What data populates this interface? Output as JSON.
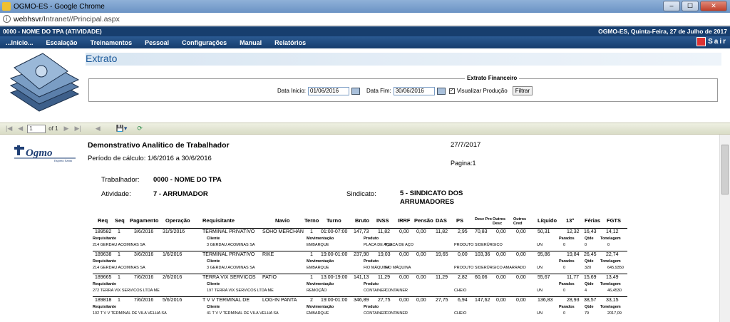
{
  "window": {
    "title": "OGMO-ES - Google Chrome",
    "btn_min": "–",
    "btn_max": "☐",
    "btn_close": "✕"
  },
  "address": {
    "host": "webhsvr",
    "path": "/Intranet//Principal.aspx"
  },
  "infobar": {
    "left": "0000 - NOME DO TPA (ATIVIDADE)",
    "right": "OGMO-ES, Quinta-Feira, 27 de Julho de 2017"
  },
  "menu": [
    "...Inicio...",
    "Escalação",
    "Treinamentos",
    "Pessoal",
    "Configurações",
    "Manual",
    "Relatórios"
  ],
  "sair": "Sair",
  "page": {
    "title": "Extrato"
  },
  "filter": {
    "legend": "Extrato Financeiro",
    "data_inicio_label": "Data Inicio:",
    "data_inicio": "01/06/2016",
    "data_fim_label": "Data Fim:",
    "data_fim": "30/06/2016",
    "visualizar_label": "Visualizar Produção",
    "filtrar": "Filtrar"
  },
  "toolbar": {
    "page": "1",
    "of": "of 1"
  },
  "report": {
    "logo_text": "Ogmo",
    "logo_sub": "Espírito Santo",
    "title": "Demonstrativo Analítico de Trabalhador",
    "date": "27/7/2017",
    "periodo": "Período de cálculo: 1/6/2016 a 30/6/2016",
    "pagina": "Pagina:1",
    "trabalhador_label": "Trabalhador:",
    "trabalhador": "0000 - NOME DO TPA",
    "atividade_label": "Atividade:",
    "atividade": "7 - ARRUMADOR",
    "sindicato_label": "Sindicato:",
    "sindicato_1": "5 - SINDICATO DOS",
    "sindicato_2": "ARRUMADORES",
    "headers": [
      "Req",
      "Seq",
      "Pagamento",
      "Operação",
      "Requisitante",
      "Navio",
      "Terno",
      "Turno",
      "Bruto",
      "INSS",
      "IRRF",
      "Pensão",
      "DAS",
      "PS",
      "Desc Pro",
      "Outros Desc",
      "Outros Cred",
      "Líquido",
      "13°",
      "Férias",
      "FGTS"
    ],
    "sub_headers": [
      "Requisitante",
      "Cliente",
      "Movimentação",
      "Produto",
      "Parados",
      "Qtde",
      "Tonelagem"
    ],
    "rows": [
      {
        "cells": [
          "189582",
          "1",
          "3/6/2016",
          "31/5/2016",
          "TERMINAL PRIVATIVO",
          "SOHO MERCHAN",
          "1",
          "01:00-07:00",
          "147,73",
          "11,82",
          "0,00",
          "0,00",
          "11,82",
          "2,95",
          "70,83",
          "0,00",
          "0,00",
          "50,31",
          "12,32",
          "16,43",
          "14,12"
        ],
        "sub": [
          "214 GERDAU ACOMINAS SA",
          "3 GERDAU ACOMINAS SA",
          "EMBARQUE",
          "PLACA DE AÇO",
          "PLACA DE AÇO",
          "PRODUTO SIDERÚRGICO",
          "UN",
          "0",
          "0",
          "0"
        ]
      },
      {
        "cells": [
          "189638",
          "1",
          "3/6/2016",
          "1/6/2016",
          "TERMINAL PRIVATIVO",
          "RIKE",
          "1",
          "19:00-01:00",
          "237,90",
          "19,03",
          "0,00",
          "0,00",
          "19,65",
          "0,00",
          "103,36",
          "0,00",
          "0,00",
          "95,86",
          "19,84",
          "26,45",
          "22,74"
        ],
        "sub": [
          "214 GERDAU ACOMINAS SA",
          "3 GERDAU ACOMINAS SA",
          "EMBARQUE",
          "FIO MÁQUINA",
          "FIO MÁQUINA",
          "PRODUTO SIDERÚRGICO AMARRADO",
          "UN",
          "0",
          "320",
          "645,9350"
        ]
      },
      {
        "cells": [
          "189665",
          "1",
          "7/6/2016",
          "2/6/2016",
          "TERRA VIX SERVICOS",
          "PATIO",
          "1",
          "13:00-19:00",
          "141,13",
          "11,29",
          "0,00",
          "0,00",
          "11,29",
          "2,82",
          "60,06",
          "0,00",
          "0,00",
          "55,67",
          "11,77",
          "15,69",
          "13,49"
        ],
        "sub": [
          "272 TERRA VIX SERVICOS LTDA ME",
          "197 TERRA VIX SERVICOS LTDA ME",
          "REMOÇÃO",
          "CONTAINER",
          "CONTAINER",
          "CHEIO",
          "UN",
          "0",
          "4",
          "46,4530"
        ]
      },
      {
        "cells": [
          "189818",
          "1",
          "7/6/2016",
          "5/6/2016",
          "T V V TERMINAL DE",
          "LOG-IN PANTA",
          "2",
          "19:00-01:00",
          "346,89",
          "27,75",
          "0,00",
          "0,00",
          "27,75",
          "6,94",
          "147,62",
          "0,00",
          "0,00",
          "136,83",
          "28,93",
          "38,57",
          "33,15"
        ],
        "sub": [
          "102 T V V TERMINAL DE VILA VELHA SA",
          "41 T V V TERMINAL DE VILA VELHA SA",
          "EMBARQUE",
          "CONTAINER",
          "CONTAINER",
          "CHEIO",
          "UN",
          "0",
          "79",
          "2017,09"
        ]
      }
    ]
  },
  "colors": {
    "menubar": "#1f4b80",
    "title": "#1c5a9a",
    "toolbar": "#e4e6d2"
  }
}
